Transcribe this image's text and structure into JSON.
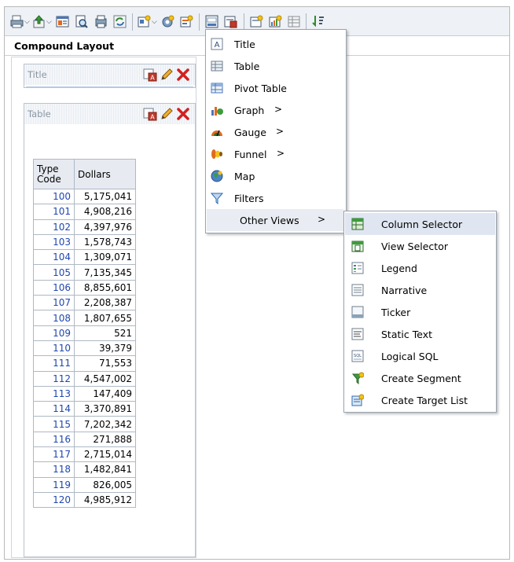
{
  "toolbar": {
    "buttons": [
      "print-icon",
      "export-icon",
      "preview-icon",
      "print-preview-icon",
      "copy-icon",
      "refresh-icon",
      "new-view-icon",
      "settings-icon",
      "filters-icon",
      "edit-icon",
      "properties-icon",
      "hide-icon",
      "chart-icon",
      "table-icon",
      "sort-icon"
    ]
  },
  "layout": {
    "title": "Compound Layout"
  },
  "views": {
    "title": {
      "label": "Title"
    },
    "table": {
      "label": "Table"
    }
  },
  "table": {
    "headers": [
      "Type\nCode",
      "Dollars"
    ],
    "rows": [
      [
        "100",
        "5,175,041"
      ],
      [
        "101",
        "4,908,216"
      ],
      [
        "102",
        "4,397,976"
      ],
      [
        "103",
        "1,578,743"
      ],
      [
        "104",
        "1,309,071"
      ],
      [
        "105",
        "7,135,345"
      ],
      [
        "106",
        "8,855,601"
      ],
      [
        "107",
        "2,208,387"
      ],
      [
        "108",
        "1,807,655"
      ],
      [
        "109",
        "521"
      ],
      [
        "110",
        "39,379"
      ],
      [
        "111",
        "71,553"
      ],
      [
        "112",
        "4,547,002"
      ],
      [
        "113",
        "147,409"
      ],
      [
        "114",
        "3,370,891"
      ],
      [
        "115",
        "7,202,342"
      ],
      [
        "116",
        "271,888"
      ],
      [
        "117",
        "2,715,014"
      ],
      [
        "118",
        "1,482,841"
      ],
      [
        "119",
        "826,005"
      ],
      [
        "120",
        "4,985,912"
      ]
    ]
  },
  "menu": {
    "items": [
      {
        "label": "Title",
        "icon": "title-icon",
        "submenu": false
      },
      {
        "label": "Table",
        "icon": "table-icon",
        "submenu": false
      },
      {
        "label": "Pivot Table",
        "icon": "pivot-table-icon",
        "submenu": false
      },
      {
        "label": "Graph",
        "icon": "graph-icon",
        "submenu": true
      },
      {
        "label": "Gauge",
        "icon": "gauge-icon",
        "submenu": true
      },
      {
        "label": "Funnel",
        "icon": "funnel-icon",
        "submenu": true
      },
      {
        "label": "Map",
        "icon": "map-icon",
        "submenu": false
      },
      {
        "label": "Filters",
        "icon": "filters-icon",
        "submenu": false
      },
      {
        "label": "Other Views",
        "icon": "",
        "submenu": true
      }
    ],
    "submenu_arrow": ">"
  },
  "submenu": {
    "items": [
      {
        "label": "Column Selector",
        "icon": "column-selector-icon"
      },
      {
        "label": "View Selector",
        "icon": "view-selector-icon"
      },
      {
        "label": "Legend",
        "icon": "legend-icon"
      },
      {
        "label": "Narrative",
        "icon": "narrative-icon"
      },
      {
        "label": "Ticker",
        "icon": "ticker-icon"
      },
      {
        "label": "Static Text",
        "icon": "static-text-icon"
      },
      {
        "label": "Logical SQL",
        "icon": "logical-sql-icon"
      },
      {
        "label": "Create Segment",
        "icon": "create-segment-icon"
      },
      {
        "label": "Create Target List",
        "icon": "create-target-list-icon"
      }
    ]
  },
  "colors": {
    "accent": "#1f47b0",
    "delete": "#d32020",
    "menu_highlight": "#dfe6f1"
  }
}
